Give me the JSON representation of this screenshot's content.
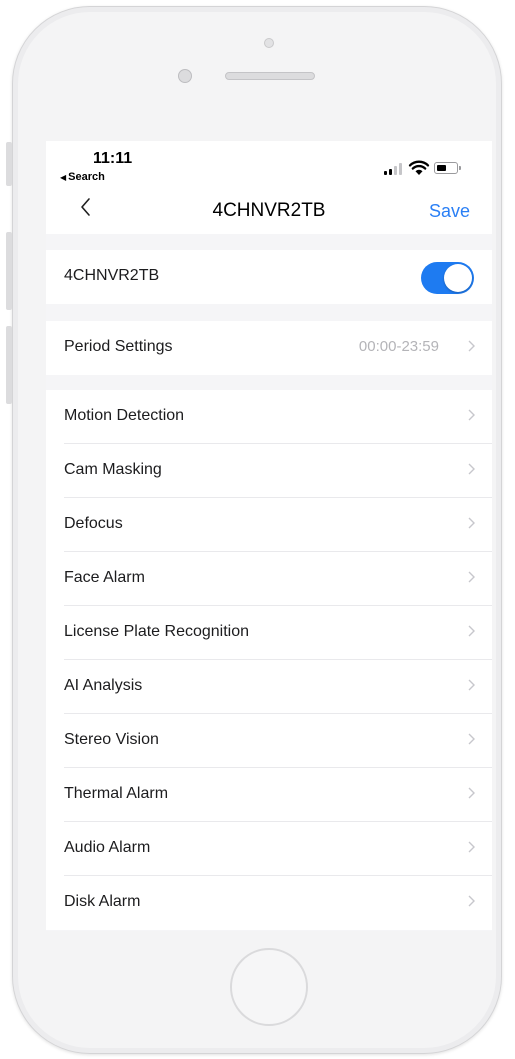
{
  "status_bar": {
    "time": "11:11",
    "back_app": "Search",
    "back_arrow_icon": "triangle-left-icon",
    "signal_icon": "cellular-signal-icon",
    "wifi_icon": "wifi-icon",
    "battery_icon": "battery-icon",
    "battery_level": 0.4
  },
  "navbar": {
    "title": "4CHNVR2TB",
    "save_label": "Save",
    "back_icon": "chevron-left-icon"
  },
  "device_toggle": {
    "label": "4CHNVR2TB",
    "enabled": true,
    "accent_color": "#1e7bf1"
  },
  "period": {
    "label": "Period Settings",
    "value": "00:00-23:59"
  },
  "alarm_items": [
    {
      "label": "Motion Detection"
    },
    {
      "label": "Cam Masking"
    },
    {
      "label": "Defocus"
    },
    {
      "label": "Face Alarm"
    },
    {
      "label": "License Plate Recognition"
    },
    {
      "label": "AI Analysis"
    },
    {
      "label": "Stereo Vision"
    },
    {
      "label": "Thermal Alarm"
    },
    {
      "label": "Audio Alarm"
    },
    {
      "label": "Disk Alarm"
    }
  ],
  "colors": {
    "link": "#2a7ff5",
    "background": "#f5f5f7",
    "secondary_text": "#b4b4b8"
  }
}
